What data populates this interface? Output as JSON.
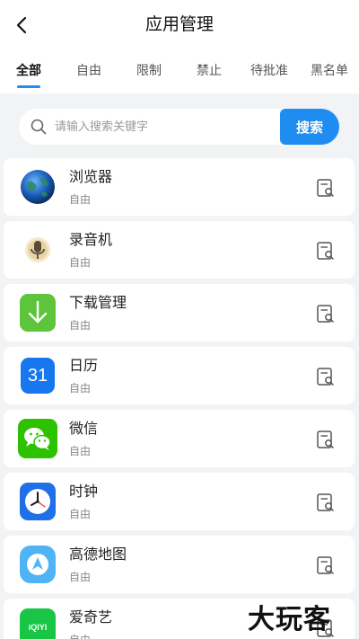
{
  "header": {
    "title": "应用管理"
  },
  "tabs": [
    {
      "label": "全部",
      "active": true
    },
    {
      "label": "自由",
      "active": false
    },
    {
      "label": "限制",
      "active": false
    },
    {
      "label": "禁止",
      "active": false
    },
    {
      "label": "待批准",
      "active": false
    },
    {
      "label": "黑名单",
      "active": false
    }
  ],
  "search": {
    "placeholder": "请输入搜索关键字",
    "button_label": "搜索"
  },
  "apps": [
    {
      "name": "浏览器",
      "status": "自由",
      "icon": "globe-icon"
    },
    {
      "name": "录音机",
      "status": "自由",
      "icon": "recorder-icon"
    },
    {
      "name": "下载管理",
      "status": "自由",
      "icon": "download-icon",
      "icon_text": ""
    },
    {
      "name": "日历",
      "status": "自由",
      "icon": "calendar-icon",
      "icon_text": "31"
    },
    {
      "name": "微信",
      "status": "自由",
      "icon": "wechat-icon"
    },
    {
      "name": "时钟",
      "status": "自由",
      "icon": "clock-icon"
    },
    {
      "name": "高德地图",
      "status": "自由",
      "icon": "map-icon"
    },
    {
      "name": "爱奇艺",
      "status": "自由",
      "icon": "iqiyi-icon",
      "icon_text": "iQIYI"
    }
  ],
  "watermark": "大玩客",
  "colors": {
    "accent": "#1e8cf0",
    "background": "#f2f3f5"
  }
}
